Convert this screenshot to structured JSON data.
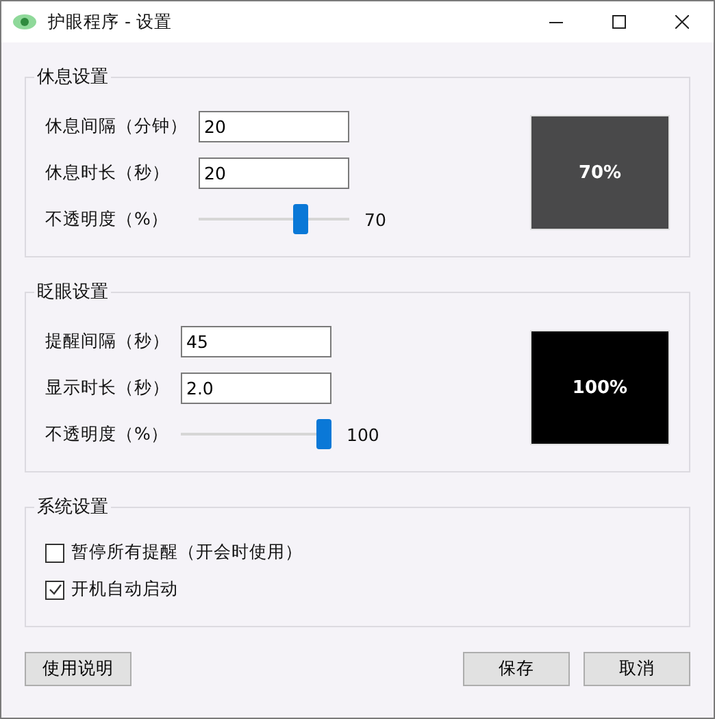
{
  "window": {
    "title": "护眼程序 - 设置"
  },
  "sections": [
    {
      "title": "休息设置",
      "fields": [
        {
          "label": "休息间隔（分钟）",
          "value": "20"
        },
        {
          "label": "休息时长（秒）",
          "value": "20"
        }
      ],
      "opacity": {
        "label": "不透明度（%）",
        "level": 0.7,
        "reading": "70"
      },
      "preview": "70%"
    },
    {
      "title": "眨眼设置",
      "fields": [
        {
          "label": "提醒间隔（秒）",
          "value": "45"
        },
        {
          "label": "显示时长（秒）",
          "value": "2.0"
        }
      ],
      "opacity": {
        "label": "不透明度（%）",
        "level": 1.0,
        "reading": "100"
      },
      "preview": "100%"
    }
  ],
  "system": {
    "title": "系统设置",
    "options": [
      {
        "label": "暂停所有提醒（开会时使用）",
        "checked": false
      },
      {
        "label": "开机自动启动",
        "checked": true
      }
    ]
  },
  "buttons": {
    "help": "使用说明",
    "save": "保存",
    "cancel": "取消"
  }
}
